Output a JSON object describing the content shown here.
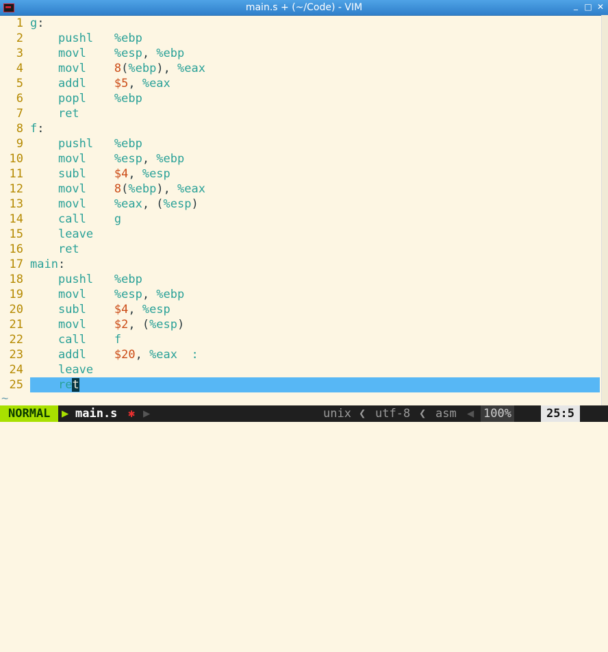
{
  "window": {
    "title": "main.s + (~/Code) - VIM",
    "min_glyph": "_",
    "max_glyph": "□",
    "close_glyph": "✕"
  },
  "lines": [
    {
      "n": "1",
      "label": "g",
      "colon": ":"
    },
    {
      "n": "2",
      "op": "pushl",
      "a1": "%ebp"
    },
    {
      "n": "3",
      "op": "movl",
      "a1": "%esp",
      "a2": "%ebp"
    },
    {
      "n": "4",
      "op": "movl",
      "a1num": "8",
      "a1reg": "%ebp",
      "a2": "%eax"
    },
    {
      "n": "5",
      "op": "addl",
      "a1num": "$5",
      "a2": "%eax"
    },
    {
      "n": "6",
      "op": "popl",
      "a1": "%ebp"
    },
    {
      "n": "7",
      "op": "ret"
    },
    {
      "n": "8",
      "label": "f",
      "colon": ":"
    },
    {
      "n": "9",
      "op": "pushl",
      "a1": "%ebp"
    },
    {
      "n": "10",
      "op": "movl",
      "a1": "%esp",
      "a2": "%ebp"
    },
    {
      "n": "11",
      "op": "subl",
      "a1num": "$4",
      "a2": "%esp"
    },
    {
      "n": "12",
      "op": "movl",
      "a1num": "8",
      "a1reg": "%ebp",
      "a2": "%eax"
    },
    {
      "n": "13",
      "op": "movl",
      "a1": "%eax",
      "a2paren": "%esp"
    },
    {
      "n": "14",
      "op": "call",
      "a1": "g"
    },
    {
      "n": "15",
      "op": "leave"
    },
    {
      "n": "16",
      "op": "ret"
    },
    {
      "n": "17",
      "label": "main",
      "colon": ":"
    },
    {
      "n": "18",
      "op": "pushl",
      "a1": "%ebp"
    },
    {
      "n": "19",
      "op": "movl",
      "a1": "%esp",
      "a2": "%ebp"
    },
    {
      "n": "20",
      "op": "subl",
      "a1num": "$4",
      "a2": "%esp"
    },
    {
      "n": "21",
      "op": "movl",
      "a1num": "$2",
      "a2paren": "%esp"
    },
    {
      "n": "22",
      "op": "call",
      "a1": "f"
    },
    {
      "n": "23",
      "op": "addl",
      "a1num": "$20",
      "a2": "%eax",
      "trail": ":"
    },
    {
      "n": "24",
      "op": "leave"
    },
    {
      "n": "25",
      "op": "re",
      "cursor_char": "t"
    }
  ],
  "tilde": "~",
  "status": {
    "mode": "NORMAL",
    "arrow": "▶",
    "filename": "main.s",
    "modified_flag": "✱",
    "fileformat": "unix",
    "sep": "❮",
    "encoding": "utf-8",
    "filetype": "asm",
    "left_arrow": "◀",
    "percent": "100%",
    "position": "25:5"
  },
  "colors": {
    "background": "#fdf6e3",
    "line_number": "#b58900",
    "keyword": "#2aa198",
    "number": "#cb4b16",
    "cursorline": "#57b7f5",
    "mode_bg": "#a8e000"
  }
}
